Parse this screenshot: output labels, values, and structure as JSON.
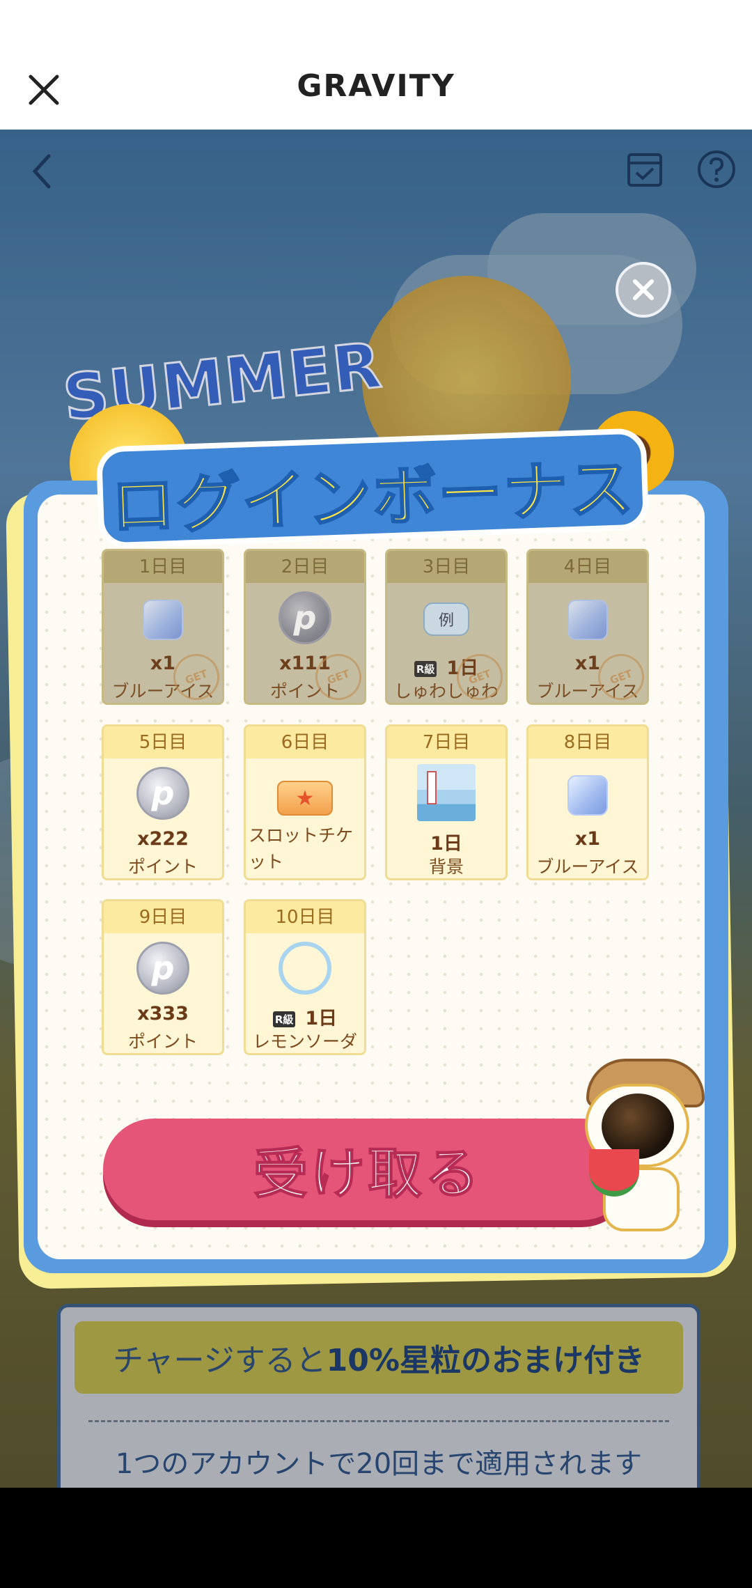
{
  "app_bar": {
    "title": "GRAVITY",
    "close_icon": "close-icon"
  },
  "page_nav": {
    "back_icon": "chevron-left-icon",
    "calendar_icon": "calendar-check-icon",
    "help_icon": "help-icon"
  },
  "background": {
    "event_title": "SUMMER"
  },
  "charge_banner": {
    "text_prefix": "チャージすると",
    "text_bold": "10%星粒のおまけ付き",
    "note": "1つのアカウントで20回まで適用されます"
  },
  "login_bonus": {
    "title": "ログインボーナス",
    "claimed_stamp": "GET",
    "days": [
      {
        "label": "1日目",
        "qty": "x1",
        "name": "ブルーアイス",
        "icon": "blue-ice-icon",
        "claimed": true
      },
      {
        "label": "2日目",
        "qty": "x111",
        "name": "ポイント",
        "icon": "point-coin-icon",
        "claimed": true
      },
      {
        "label": "3日目",
        "qty": "1日",
        "rank": "R級",
        "name": "しゅわしゅわ",
        "icon": "speech-bubble-icon",
        "icon_text": "例",
        "claimed": true
      },
      {
        "label": "4日目",
        "qty": "x1",
        "name": "ブルーアイス",
        "icon": "blue-ice-icon",
        "claimed": true
      },
      {
        "label": "5日目",
        "qty": "x222",
        "name": "ポイント",
        "icon": "point-coin-icon",
        "claimed": false
      },
      {
        "label": "6日目",
        "qty": "",
        "name": "スロットチケット",
        "icon": "slot-ticket-icon",
        "claimed": false
      },
      {
        "label": "7日目",
        "qty": "1日",
        "name": "背景",
        "icon": "background-scene-icon",
        "claimed": false
      },
      {
        "label": "8日目",
        "qty": "x1",
        "name": "ブルーアイス",
        "icon": "blue-ice-icon",
        "claimed": false
      },
      {
        "label": "9日目",
        "qty": "x333",
        "name": "ポイント",
        "icon": "point-coin-icon",
        "claimed": false
      },
      {
        "label": "10日目",
        "qty": "1日",
        "rank": "R級",
        "name": "レモンソーダ",
        "icon": "ring-frame-icon",
        "claimed": false
      }
    ],
    "claim_button": "受け取る",
    "close_icon": "close-circle-icon"
  },
  "colors": {
    "dialog_blue": "#5a9be0",
    "button_pink": "#e45578",
    "title_yellow": "#ffe545"
  }
}
